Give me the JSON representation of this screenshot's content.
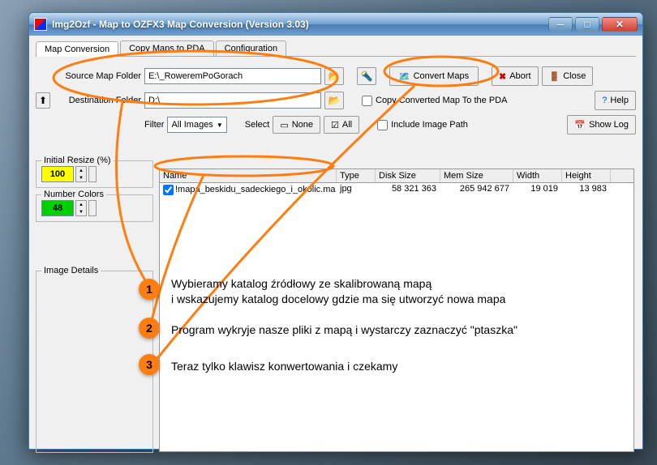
{
  "window": {
    "title": "Img2Ozf - Map to OZFX3 Map Conversion (Version 3.03)"
  },
  "tabs": [
    {
      "label": "Map Conversion"
    },
    {
      "label": "Copy Maps to PDA"
    },
    {
      "label": "Configuration"
    }
  ],
  "paths": {
    "source_label": "Source Map Folder",
    "source_value": "E:\\_RoweremPoGorach",
    "dest_label": "Destination Folder",
    "dest_value": "D:\\"
  },
  "filterRow": {
    "filter_label": "Filter",
    "filter_value": "All Images",
    "select_label": "Select",
    "none_label": "None",
    "all_label": "All"
  },
  "buttons": {
    "convert": "Convert Maps",
    "abort": "Abort",
    "close": "Close",
    "help": "Help",
    "showlog": "Show Log"
  },
  "checks": {
    "copy_pda": "Copy Converted Map To the PDA",
    "include_path": "Include Image Path"
  },
  "resize": {
    "title": "Initial Resize (%)",
    "value": "100"
  },
  "colors": {
    "title": "Number Colors",
    "value": "48"
  },
  "details": {
    "title": "Image Details"
  },
  "list": {
    "headers": {
      "name": "Name",
      "type": "Type",
      "disk": "Disk Size",
      "mem": "Mem Size",
      "width": "Width",
      "height": "Height"
    },
    "rows": [
      {
        "checked": true,
        "name": "!mapa_beskidu_sadeckiego_i_okolic.map",
        "type": "jpg",
        "disk": "58 321 363",
        "mem": "265 942 677",
        "width": "19 019",
        "height": "13 983"
      }
    ]
  },
  "annotations": {
    "n1": {
      "num": "1",
      "text1": "Wybieramy katalog źródłowy ze skalibrowaną mapą",
      "text2": "i wskazujemy katalog docelowy gdzie ma się utworzyć nowa mapa"
    },
    "n2": {
      "num": "2",
      "text": "Program wykryje nasze pliki z mapą i wystarczy zaznaczyć \"ptaszka\""
    },
    "n3": {
      "num": "3",
      "text": "Teraz tylko klawisz konwertowania i czekamy"
    }
  }
}
